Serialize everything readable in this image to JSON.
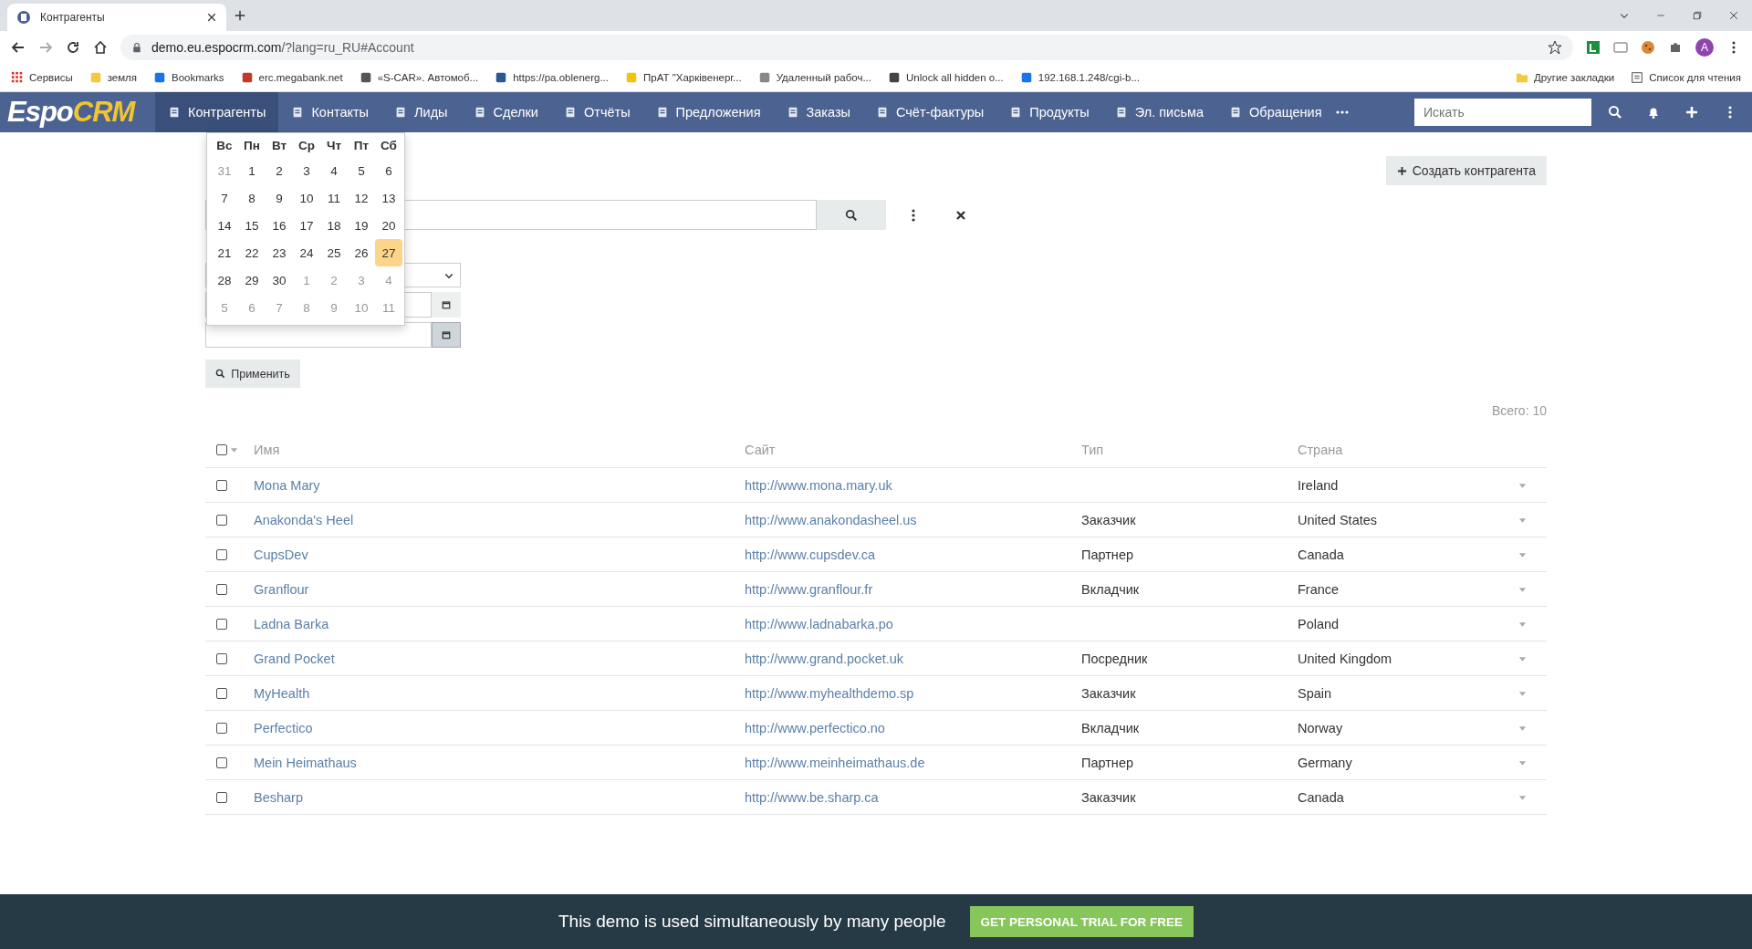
{
  "browser": {
    "tab_title": "Контрагенты",
    "address_host": "demo.eu.espocrm.com",
    "address_path": "/?lang=ru_RU#Account",
    "profile_initial": "A",
    "bookmarks": [
      "Сервисы",
      "земля",
      "Bookmarks",
      "erc.megabank.net",
      "«S-CAR». Автомоб...",
      "https://pa.oblenerg...",
      "ПрАТ \"Харківенерг...",
      "Удаленный рабоч...",
      "Unlock all hidden o...",
      "192.168.1.248/cgi-b..."
    ],
    "bookmarks_right": [
      "Другие закладки",
      "Список для чтения"
    ]
  },
  "app": {
    "logo_1": "Espo",
    "logo_2": "CRM",
    "nav": [
      {
        "label": "Контрагенты",
        "selected": true
      },
      {
        "label": "Контакты",
        "selected": false
      },
      {
        "label": "Лиды",
        "selected": false
      },
      {
        "label": "Сделки",
        "selected": false
      },
      {
        "label": "Отчёты",
        "selected": false
      },
      {
        "label": "Предложения",
        "selected": false
      },
      {
        "label": "Заказы",
        "selected": false
      },
      {
        "label": "Счёт-фактуры",
        "selected": false
      },
      {
        "label": "Продукты",
        "selected": false
      },
      {
        "label": "Эл. письма",
        "selected": false
      },
      {
        "label": "Обращения",
        "selected": false
      }
    ],
    "search_placeholder": "Искать"
  },
  "create_button": "Создать контрагента",
  "apply_button": "Применить",
  "calendar": {
    "weekdays": [
      "Вс",
      "Пн",
      "Вт",
      "Ср",
      "Чт",
      "Пт",
      "Сб"
    ],
    "weeks": [
      [
        {
          "d": "31",
          "other_month": true,
          "selected": false
        },
        {
          "d": "1",
          "other_month": false,
          "selected": false
        },
        {
          "d": "2",
          "other_month": false,
          "selected": false
        },
        {
          "d": "3",
          "other_month": false,
          "selected": false
        },
        {
          "d": "4",
          "other_month": false,
          "selected": false
        },
        {
          "d": "5",
          "other_month": false,
          "selected": false
        },
        {
          "d": "6",
          "other_month": false,
          "selected": false
        }
      ],
      [
        {
          "d": "7",
          "other_month": false,
          "selected": false
        },
        {
          "d": "8",
          "other_month": false,
          "selected": false
        },
        {
          "d": "9",
          "other_month": false,
          "selected": false
        },
        {
          "d": "10",
          "other_month": false,
          "selected": false
        },
        {
          "d": "11",
          "other_month": false,
          "selected": false
        },
        {
          "d": "12",
          "other_month": false,
          "selected": false
        },
        {
          "d": "13",
          "other_month": false,
          "selected": false
        }
      ],
      [
        {
          "d": "14",
          "other_month": false,
          "selected": false
        },
        {
          "d": "15",
          "other_month": false,
          "selected": false
        },
        {
          "d": "16",
          "other_month": false,
          "selected": false
        },
        {
          "d": "17",
          "other_month": false,
          "selected": false
        },
        {
          "d": "18",
          "other_month": false,
          "selected": false
        },
        {
          "d": "19",
          "other_month": false,
          "selected": false
        },
        {
          "d": "20",
          "other_month": false,
          "selected": false
        }
      ],
      [
        {
          "d": "21",
          "other_month": false,
          "selected": false
        },
        {
          "d": "22",
          "other_month": false,
          "selected": false
        },
        {
          "d": "23",
          "other_month": false,
          "selected": false
        },
        {
          "d": "24",
          "other_month": false,
          "selected": false
        },
        {
          "d": "25",
          "other_month": false,
          "selected": false
        },
        {
          "d": "26",
          "other_month": false,
          "selected": false
        },
        {
          "d": "27",
          "other_month": false,
          "selected": true
        }
      ],
      [
        {
          "d": "28",
          "other_month": false,
          "selected": false
        },
        {
          "d": "29",
          "other_month": false,
          "selected": false
        },
        {
          "d": "30",
          "other_month": false,
          "selected": false
        },
        {
          "d": "1",
          "other_month": true,
          "selected": false
        },
        {
          "d": "2",
          "other_month": true,
          "selected": false
        },
        {
          "d": "3",
          "other_month": true,
          "selected": false
        },
        {
          "d": "4",
          "other_month": true,
          "selected": false
        }
      ],
      [
        {
          "d": "5",
          "other_month": true,
          "selected": false
        },
        {
          "d": "6",
          "other_month": true,
          "selected": false
        },
        {
          "d": "7",
          "other_month": true,
          "selected": false
        },
        {
          "d": "8",
          "other_month": true,
          "selected": false
        },
        {
          "d": "9",
          "other_month": true,
          "selected": false
        },
        {
          "d": "10",
          "other_month": true,
          "selected": false
        },
        {
          "d": "11",
          "other_month": true,
          "selected": false
        }
      ]
    ]
  },
  "total": "Всего: 10",
  "table": {
    "columns": [
      "Имя",
      "Сайт",
      "Тип",
      "Страна"
    ],
    "select_all_checked": false,
    "rows": [
      {
        "name": "Mona Mary",
        "site": "http://www.mona.mary.uk",
        "country": "Ireland",
        "checked": false
      },
      {
        "name": "Anakonda's Heel",
        "site": "http://www.anakondasheel.us",
        "type": "Заказчик",
        "country": "United States",
        "checked": false
      },
      {
        "name": "CupsDev",
        "site": "http://www.cupsdev.ca",
        "type": "Партнер",
        "country": "Canada",
        "checked": false
      },
      {
        "name": "Granflour",
        "site": "http://www.granflour.fr",
        "type": "Вкладчик",
        "country": "France",
        "checked": false
      },
      {
        "name": "Ladna Barka",
        "site": "http://www.ladnabarka.po",
        "country": "Poland",
        "checked": false
      },
      {
        "name": "Grand Pocket",
        "site": "http://www.grand.pocket.uk",
        "type": "Посредник",
        "country": "United Kingdom",
        "checked": false
      },
      {
        "name": "MyHealth",
        "site": "http://www.myhealthdemo.sp",
        "type": "Заказчик",
        "country": "Spain",
        "checked": false
      },
      {
        "name": "Perfectico",
        "site": "http://www.perfectico.no",
        "type": "Вкладчик",
        "country": "Norway",
        "checked": false
      },
      {
        "name": "Mein Heimathaus",
        "site": "http://www.meinheimathaus.de",
        "type": "Партнер",
        "country": "Germany",
        "checked": false
      },
      {
        "name": "Besharp",
        "site": "http://www.be.sharp.ca",
        "type": "Заказчик",
        "country": "Canada",
        "checked": false
      }
    ]
  },
  "banner": {
    "text": "This demo is used simultaneously by many people",
    "button": "GET PERSONAL TRIAL FOR FREE"
  }
}
